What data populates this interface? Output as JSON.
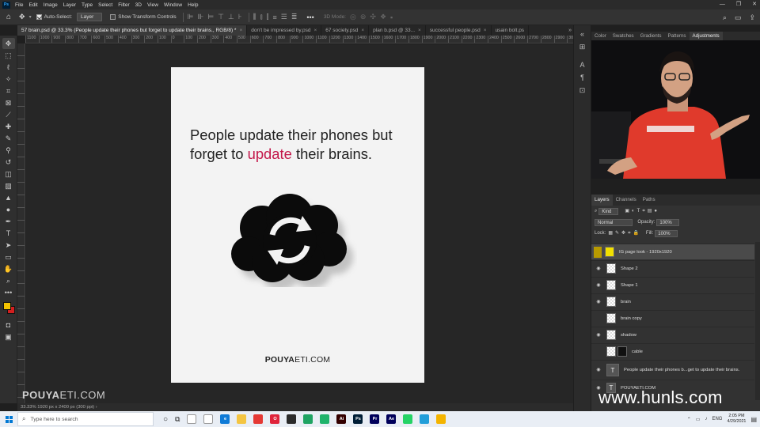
{
  "menu": {
    "app_icon_label": "Ps",
    "items": [
      "File",
      "Edit",
      "Image",
      "Layer",
      "Type",
      "Select",
      "Filter",
      "3D",
      "View",
      "Window",
      "Help"
    ]
  },
  "options": {
    "auto_select_label": "Auto-Select:",
    "auto_select_value": "Layer",
    "transform_controls_label": "Show Transform Controls",
    "mode_3d_label": "3D Mode:"
  },
  "tabs": [
    {
      "label": "57 brain.psd @ 33.3% (People update their phones but forget to update their brains., RGB/8) *",
      "active": true
    },
    {
      "label": "don't be impressed by.psd",
      "active": false
    },
    {
      "label": "67 society.psd",
      "active": false
    },
    {
      "label": "plan b.psd @ 33...",
      "active": false
    },
    {
      "label": "successful people.psd",
      "active": false
    },
    {
      "label": "usain bolt.ps",
      "active": false
    }
  ],
  "tab_more": "»",
  "ruler_ticks": [
    "1100",
    "1000",
    "900",
    "800",
    "700",
    "600",
    "500",
    "400",
    "300",
    "200",
    "100",
    "0",
    "100",
    "200",
    "300",
    "400",
    "500",
    "600",
    "700",
    "800",
    "900",
    "1000",
    "1100",
    "1200",
    "1300",
    "1400",
    "1500",
    "1600",
    "1700",
    "1800",
    "1900",
    "2000",
    "2100",
    "2200",
    "2300",
    "2400",
    "2500",
    "2600",
    "2700",
    "2800",
    "2900",
    "3000",
    "3100",
    "3200",
    "3300",
    "3400"
  ],
  "document": {
    "headline_part1": "People update their phones but forget to ",
    "headline_accent": "update",
    "headline_part2": " their brains.",
    "brand_bold": "POUYA",
    "brand_rest": "ETI.COM",
    "accent_color": "#c3174a"
  },
  "status_text": "33.33%   1920 px x 2400 px (300 ppi)   ›",
  "overlay_brand_bold": "POUYA",
  "overlay_brand_rest": "ETI.COM",
  "panel_tabs": [
    "Color",
    "Swatches",
    "Gradients",
    "Patterns",
    "Adjustments"
  ],
  "layers_panel": {
    "tabs": [
      "Layers",
      "Channels",
      "Paths"
    ],
    "filter_kind": "Kind",
    "blend_mode": "Normal",
    "opacity_label": "Opacity:",
    "opacity_value": "100%",
    "lock_label": "Lock:",
    "fill_label": "Fill:",
    "fill_value": "100%",
    "layers": [
      {
        "name": "IG page look - 1920x1920",
        "thumb": "yellow",
        "visible": false,
        "highlight": true
      },
      {
        "name": "Shape 2",
        "thumb": "checker",
        "visible": true,
        "highlight": false
      },
      {
        "name": "Shape 1",
        "thumb": "checker",
        "visible": true,
        "highlight": false
      },
      {
        "name": "brain",
        "thumb": "checker",
        "visible": true,
        "highlight": false
      },
      {
        "name": "brain copy",
        "thumb": "checker",
        "visible": false,
        "highlight": false
      },
      {
        "name": "shadow",
        "thumb": "checker",
        "visible": true,
        "highlight": false
      },
      {
        "name": "cable",
        "thumb": "black",
        "visible": false,
        "highlight": false
      },
      {
        "name": "People update their phones b...get to update their brains.",
        "thumb": "text",
        "visible": true,
        "highlight": false
      },
      {
        "name": "POUYAETI.COM",
        "thumb": "text",
        "visible": true,
        "highlight": false
      }
    ]
  },
  "site_watermark": "www.hunls.com",
  "taskbar": {
    "search_placeholder": "Type here to search",
    "apps": [
      {
        "label": "",
        "color": "#ffffff"
      },
      {
        "label": "",
        "color": "#ffffff"
      },
      {
        "label": "e",
        "color": "#0f7bd7"
      },
      {
        "label": "",
        "color": "#f4c542"
      },
      {
        "label": "",
        "color": "#e53935"
      },
      {
        "label": "O",
        "color": "#e0243b"
      },
      {
        "label": "",
        "color": "#2b2b2b"
      },
      {
        "label": "",
        "color": "#1fa463"
      },
      {
        "label": "",
        "color": "#1fb36b"
      },
      {
        "label": "Ai",
        "color": "#330000"
      },
      {
        "label": "Ps",
        "color": "#001e36"
      },
      {
        "label": "Pr",
        "color": "#00005b"
      },
      {
        "label": "Ae",
        "color": "#00005b"
      },
      {
        "label": "",
        "color": "#25d366"
      },
      {
        "label": "",
        "color": "#229ed9"
      },
      {
        "label": "",
        "color": "#f4b400"
      }
    ],
    "lang": "ENG",
    "time": "2:05 PM",
    "date": "4/29/2021"
  }
}
